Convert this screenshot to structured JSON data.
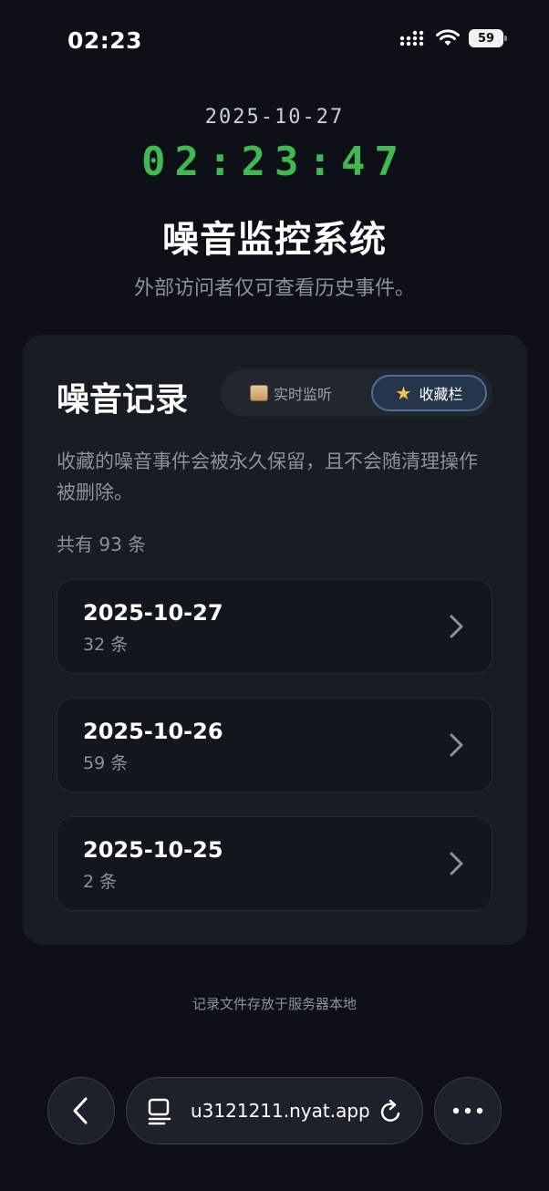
{
  "status_bar": {
    "time": "02:23",
    "battery": "59"
  },
  "header": {
    "date": "2025-10-27",
    "clock": "02:23:47",
    "title": "噪音监控系统",
    "subtitle": "外部访问者仅可查看历史事件。"
  },
  "card": {
    "title": "噪音记录",
    "tabs": [
      {
        "label": "实时监听",
        "icon": "scroll-icon",
        "active": false
      },
      {
        "label": "收藏栏",
        "icon": "star-icon",
        "active": true
      }
    ],
    "description": "收藏的噪音事件会被永久保留，且不会随清理操作被删除。",
    "count_text": "共有 93 条",
    "records": [
      {
        "date": "2025-10-27",
        "count": "32 条"
      },
      {
        "date": "2025-10-26",
        "count": "59 条"
      },
      {
        "date": "2025-10-25",
        "count": "2 条"
      }
    ]
  },
  "footer_note": "记录文件存放于服务器本地",
  "browser": {
    "url": "u3121211.nyat.app"
  },
  "colors": {
    "clock_green": "#3fb950",
    "active_tab_border": "#4b6e9a",
    "background": "#0d1117"
  }
}
